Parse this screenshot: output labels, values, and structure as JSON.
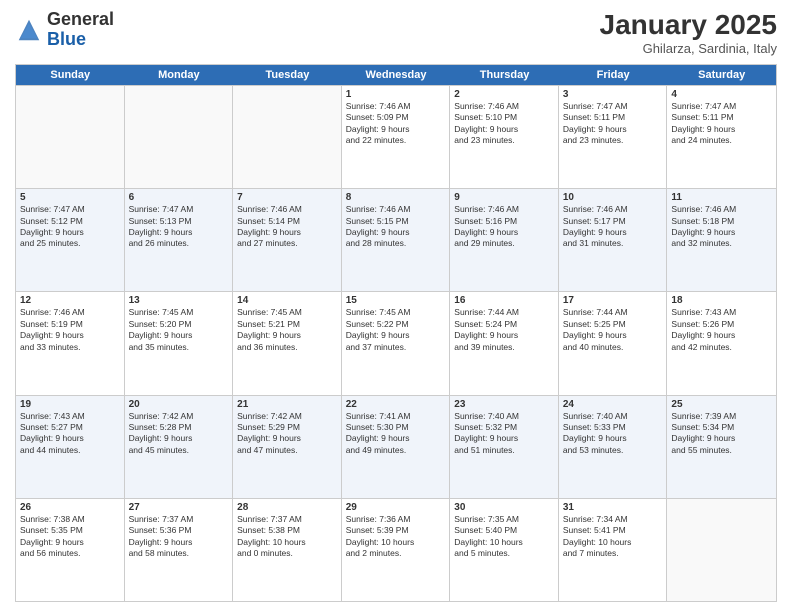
{
  "header": {
    "logo_general": "General",
    "logo_blue": "Blue",
    "month": "January 2025",
    "location": "Ghilarza, Sardinia, Italy"
  },
  "days_of_week": [
    "Sunday",
    "Monday",
    "Tuesday",
    "Wednesday",
    "Thursday",
    "Friday",
    "Saturday"
  ],
  "weeks": [
    {
      "alt": false,
      "cells": [
        {
          "day": "",
          "text": ""
        },
        {
          "day": "",
          "text": ""
        },
        {
          "day": "",
          "text": ""
        },
        {
          "day": "1",
          "text": "Sunrise: 7:46 AM\nSunset: 5:09 PM\nDaylight: 9 hours\nand 22 minutes."
        },
        {
          "day": "2",
          "text": "Sunrise: 7:46 AM\nSunset: 5:10 PM\nDaylight: 9 hours\nand 23 minutes."
        },
        {
          "day": "3",
          "text": "Sunrise: 7:47 AM\nSunset: 5:11 PM\nDaylight: 9 hours\nand 23 minutes."
        },
        {
          "day": "4",
          "text": "Sunrise: 7:47 AM\nSunset: 5:11 PM\nDaylight: 9 hours\nand 24 minutes."
        }
      ]
    },
    {
      "alt": true,
      "cells": [
        {
          "day": "5",
          "text": "Sunrise: 7:47 AM\nSunset: 5:12 PM\nDaylight: 9 hours\nand 25 minutes."
        },
        {
          "day": "6",
          "text": "Sunrise: 7:47 AM\nSunset: 5:13 PM\nDaylight: 9 hours\nand 26 minutes."
        },
        {
          "day": "7",
          "text": "Sunrise: 7:46 AM\nSunset: 5:14 PM\nDaylight: 9 hours\nand 27 minutes."
        },
        {
          "day": "8",
          "text": "Sunrise: 7:46 AM\nSunset: 5:15 PM\nDaylight: 9 hours\nand 28 minutes."
        },
        {
          "day": "9",
          "text": "Sunrise: 7:46 AM\nSunset: 5:16 PM\nDaylight: 9 hours\nand 29 minutes."
        },
        {
          "day": "10",
          "text": "Sunrise: 7:46 AM\nSunset: 5:17 PM\nDaylight: 9 hours\nand 31 minutes."
        },
        {
          "day": "11",
          "text": "Sunrise: 7:46 AM\nSunset: 5:18 PM\nDaylight: 9 hours\nand 32 minutes."
        }
      ]
    },
    {
      "alt": false,
      "cells": [
        {
          "day": "12",
          "text": "Sunrise: 7:46 AM\nSunset: 5:19 PM\nDaylight: 9 hours\nand 33 minutes."
        },
        {
          "day": "13",
          "text": "Sunrise: 7:45 AM\nSunset: 5:20 PM\nDaylight: 9 hours\nand 35 minutes."
        },
        {
          "day": "14",
          "text": "Sunrise: 7:45 AM\nSunset: 5:21 PM\nDaylight: 9 hours\nand 36 minutes."
        },
        {
          "day": "15",
          "text": "Sunrise: 7:45 AM\nSunset: 5:22 PM\nDaylight: 9 hours\nand 37 minutes."
        },
        {
          "day": "16",
          "text": "Sunrise: 7:44 AM\nSunset: 5:24 PM\nDaylight: 9 hours\nand 39 minutes."
        },
        {
          "day": "17",
          "text": "Sunrise: 7:44 AM\nSunset: 5:25 PM\nDaylight: 9 hours\nand 40 minutes."
        },
        {
          "day": "18",
          "text": "Sunrise: 7:43 AM\nSunset: 5:26 PM\nDaylight: 9 hours\nand 42 minutes."
        }
      ]
    },
    {
      "alt": true,
      "cells": [
        {
          "day": "19",
          "text": "Sunrise: 7:43 AM\nSunset: 5:27 PM\nDaylight: 9 hours\nand 44 minutes."
        },
        {
          "day": "20",
          "text": "Sunrise: 7:42 AM\nSunset: 5:28 PM\nDaylight: 9 hours\nand 45 minutes."
        },
        {
          "day": "21",
          "text": "Sunrise: 7:42 AM\nSunset: 5:29 PM\nDaylight: 9 hours\nand 47 minutes."
        },
        {
          "day": "22",
          "text": "Sunrise: 7:41 AM\nSunset: 5:30 PM\nDaylight: 9 hours\nand 49 minutes."
        },
        {
          "day": "23",
          "text": "Sunrise: 7:40 AM\nSunset: 5:32 PM\nDaylight: 9 hours\nand 51 minutes."
        },
        {
          "day": "24",
          "text": "Sunrise: 7:40 AM\nSunset: 5:33 PM\nDaylight: 9 hours\nand 53 minutes."
        },
        {
          "day": "25",
          "text": "Sunrise: 7:39 AM\nSunset: 5:34 PM\nDaylight: 9 hours\nand 55 minutes."
        }
      ]
    },
    {
      "alt": false,
      "cells": [
        {
          "day": "26",
          "text": "Sunrise: 7:38 AM\nSunset: 5:35 PM\nDaylight: 9 hours\nand 56 minutes."
        },
        {
          "day": "27",
          "text": "Sunrise: 7:37 AM\nSunset: 5:36 PM\nDaylight: 9 hours\nand 58 minutes."
        },
        {
          "day": "28",
          "text": "Sunrise: 7:37 AM\nSunset: 5:38 PM\nDaylight: 10 hours\nand 0 minutes."
        },
        {
          "day": "29",
          "text": "Sunrise: 7:36 AM\nSunset: 5:39 PM\nDaylight: 10 hours\nand 2 minutes."
        },
        {
          "day": "30",
          "text": "Sunrise: 7:35 AM\nSunset: 5:40 PM\nDaylight: 10 hours\nand 5 minutes."
        },
        {
          "day": "31",
          "text": "Sunrise: 7:34 AM\nSunset: 5:41 PM\nDaylight: 10 hours\nand 7 minutes."
        },
        {
          "day": "",
          "text": ""
        }
      ]
    }
  ]
}
